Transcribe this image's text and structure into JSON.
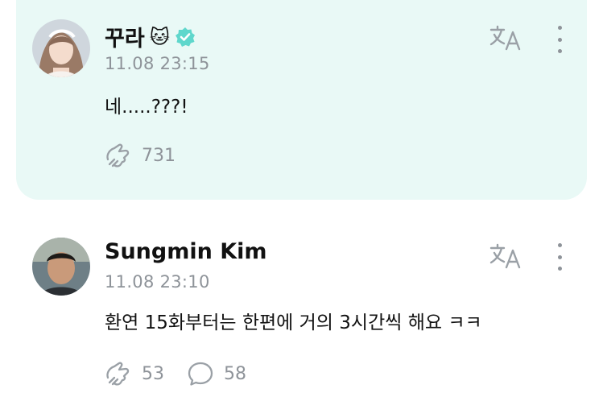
{
  "posts": [
    {
      "author": "꾸라",
      "author_emoji": "🐱",
      "verified": true,
      "timestamp": "11.08 23:15",
      "text": "네.....???!",
      "reactions": "731",
      "highlighted": true,
      "avatar_icon": "avatar-photo-woman",
      "translate_icon": "translate-icon",
      "more_icon": "more-vertical-icon"
    },
    {
      "author": "Sungmin Kim",
      "timestamp": "11.08 23:10",
      "text": "환연 15화부터는 한편에 거의 3시간씩 해요 ㅋㅋ",
      "reactions": "53",
      "comments": "58",
      "highlighted": false,
      "avatar_icon": "avatar-photo-man",
      "translate_icon": "translate-icon",
      "more_icon": "more-vertical-icon"
    }
  ],
  "colors": {
    "highlight_bg": "#e9f9f6",
    "verified_badge": "#5fd7cc",
    "muted": "#8e9399",
    "text": "#111111"
  }
}
